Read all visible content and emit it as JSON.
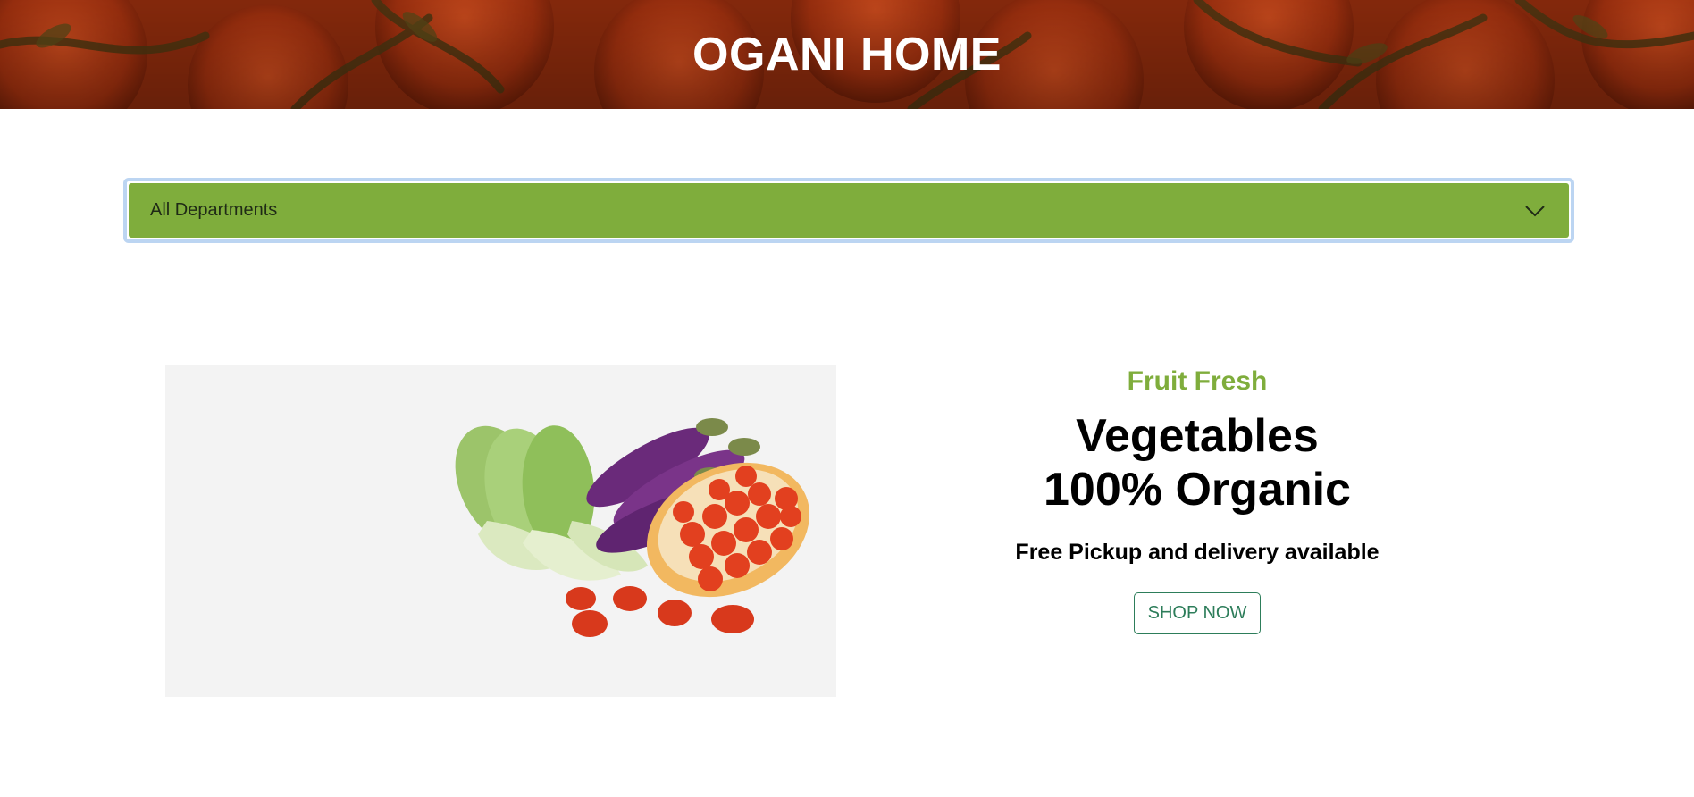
{
  "header": {
    "title": "OGANI HOME"
  },
  "departments": {
    "selected": "All Departments",
    "icon": "chevron-down-icon"
  },
  "hero": {
    "subtitle": "Fruit Fresh",
    "title_line1": "Vegetables",
    "title_line2": "100% Organic",
    "note": "Free Pickup and delivery available",
    "button_label": "SHOP NOW"
  },
  "colors": {
    "accent_green": "#7fad3c",
    "button_green": "#2d7d5a",
    "banner_red": "#8e2a0c",
    "focus_ring": "#bcd5f2"
  }
}
